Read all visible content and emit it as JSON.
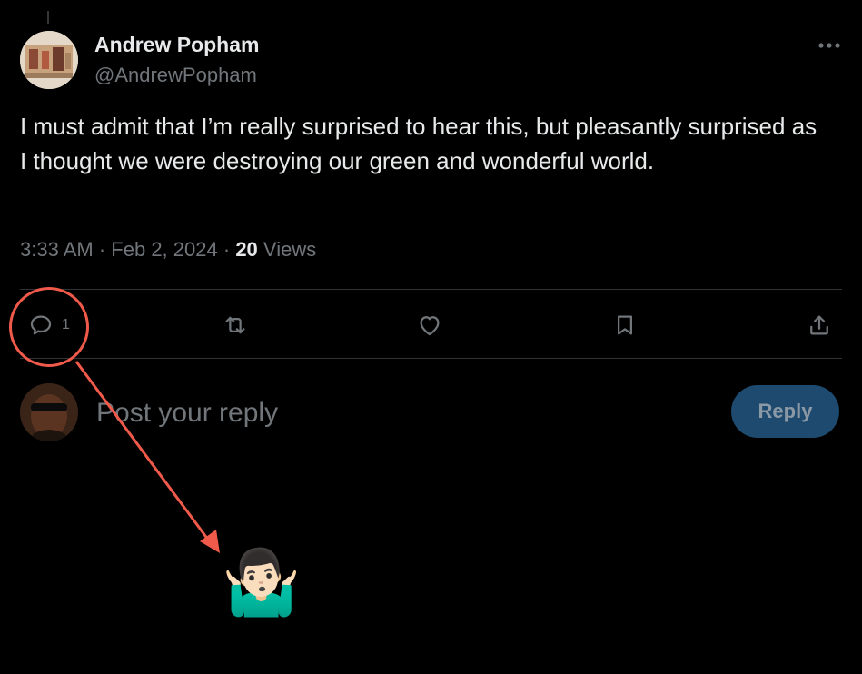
{
  "tweet": {
    "author_name": "Andrew Popham",
    "author_handle": "@AndrewPopham",
    "text": "I must admit that I’m really surprised to hear this, but pleasantly surprised as I thought we were destroying our green and wonderful world.",
    "time": "3:33 AM",
    "date": "Feb 2, 2024",
    "views_count": "20",
    "views_label": "Views",
    "separator": "·"
  },
  "actions": {
    "reply_count": "1"
  },
  "composer": {
    "placeholder": "Post your reply",
    "button_label": "Reply"
  },
  "annotation": {
    "emoji": "🤷🏻‍♂️",
    "color": "#f05a4b"
  },
  "colors": {
    "background": "#000000",
    "text": "#e7e9ea",
    "muted": "#71767b",
    "reply_button_bg": "#1d4a6e"
  }
}
